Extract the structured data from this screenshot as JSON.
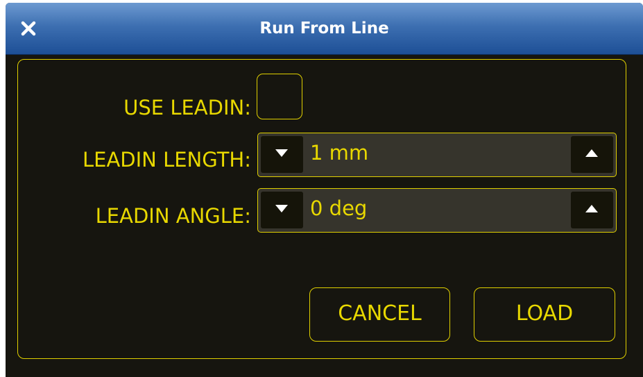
{
  "window": {
    "title": "Run From Line",
    "close_icon": "close-icon"
  },
  "form": {
    "use_leadin": {
      "label": "USE LEADIN:",
      "checked": false
    },
    "leadin_length": {
      "label": "LEADIN LENGTH:",
      "value": "1 mm",
      "decrement_icon": "triangle-down-icon",
      "increment_icon": "triangle-up-icon"
    },
    "leadin_angle": {
      "label": "LEADIN ANGLE:",
      "value": "0 deg",
      "decrement_icon": "triangle-down-icon",
      "increment_icon": "triangle-up-icon"
    }
  },
  "buttons": {
    "cancel": "CANCEL",
    "load": "LOAD"
  },
  "colors": {
    "accent": "#e8d800",
    "background": "#16150f",
    "spinbox_background": "#36342c",
    "titlebar": "#3d6fb1"
  }
}
